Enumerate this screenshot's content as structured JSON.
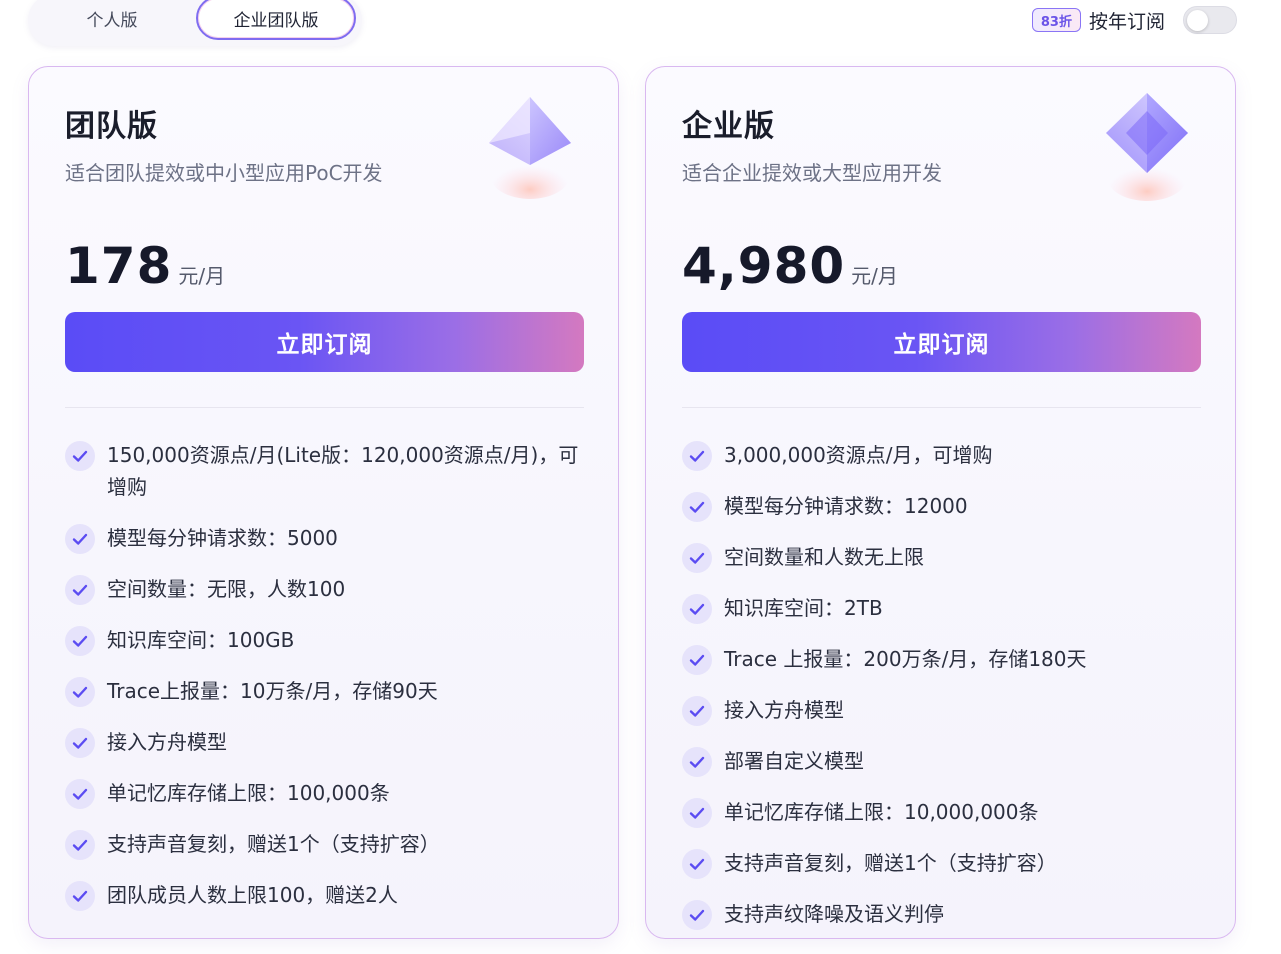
{
  "tabs": {
    "personal": "个人版",
    "team": "企业团队版"
  },
  "annual": {
    "badge": "83折",
    "label": "按年订阅",
    "enabled": false
  },
  "colors": {
    "accent": "#5a4cf6",
    "accent_end": "#d479c0",
    "check_bg": "#e6e3fb"
  },
  "plans": [
    {
      "title": "团队版",
      "desc": "适合团队提效或中小型应用PoC开发",
      "price": "178",
      "unit": "元/月",
      "button": "立即订阅",
      "icon": "diamond-gem-icon",
      "features": [
        "150,000资源点/月(Lite版：120,000资源点/月)，可增购",
        "模型每分钟请求数：5000",
        "空间数量：无限，人数100",
        "知识库空间：100GB",
        "Trace上报量：10万条/月，存储90天",
        "接入方舟模型",
        "单记忆库存储上限：100,000条",
        "支持声音复刻，赠送1个（支持扩容）",
        "团队成员人数上限100，赠送2人"
      ]
    },
    {
      "title": "企业版",
      "desc": "适合企业提效或大型应用开发",
      "price": "4,980",
      "unit": "元/月",
      "button": "立即订阅",
      "icon": "diamond-gem-icon",
      "features": [
        "3,000,000资源点/月，可增购",
        "模型每分钟请求数：12000",
        "空间数量和人数无上限",
        "知识库空间：2TB",
        "Trace 上报量：200万条/月，存储180天",
        "接入方舟模型",
        "部署自定义模型",
        "单记忆库存储上限：10,000,000条",
        "支持声音复刻，赠送1个（支持扩容）",
        "支持声纹降噪及语义判停"
      ]
    }
  ]
}
